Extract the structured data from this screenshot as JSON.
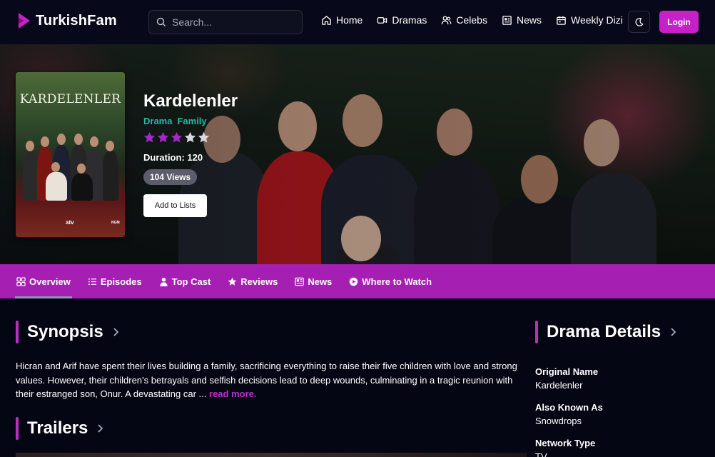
{
  "brand": {
    "name": "TurkishFam",
    "accent": "#c620c9"
  },
  "search": {
    "placeholder": "Search..."
  },
  "nav": {
    "items": [
      {
        "label": "Home",
        "icon": "home-icon"
      },
      {
        "label": "Dramas",
        "icon": "video-icon"
      },
      {
        "label": "Celebs",
        "icon": "users-icon"
      },
      {
        "label": "News",
        "icon": "newspaper-icon"
      },
      {
        "label": "Weekly Dizi",
        "icon": "calendar-icon"
      }
    ],
    "theme_icon": "moon-icon",
    "login_label": "Login"
  },
  "drama": {
    "poster_title": "KARDELENLER",
    "poster_channel": "atv",
    "poster_studio": "NGM",
    "title": "Kardelenler",
    "genres": [
      "Drama",
      "Family"
    ],
    "rating": 3,
    "rating_max": 5,
    "duration": "Duration: 120",
    "views": "104 Views",
    "add_button": "Add to Lists"
  },
  "tabs": [
    {
      "label": "Overview",
      "icon": "grid-icon",
      "active": true
    },
    {
      "label": "Episodes",
      "icon": "list-icon",
      "active": false
    },
    {
      "label": "Top Cast",
      "icon": "user-icon",
      "active": false
    },
    {
      "label": "Reviews",
      "icon": "star-icon",
      "active": false
    },
    {
      "label": "News",
      "icon": "newspaper-icon",
      "active": false
    },
    {
      "label": "Where to Watch",
      "icon": "play-circle-icon",
      "active": false
    }
  ],
  "synopsis": {
    "heading": "Synopsis",
    "text": "Hicran and Arif have spent their lives building a family, sacrificing everything to raise their five children with love and strong values. However, their children’s betrayals and selfish decisions lead to deep wounds, culminating in a tragic reunion with their estranged son, Onur. A devastating car ...",
    "read_more": "read more."
  },
  "trailers": {
    "heading": "Trailers"
  },
  "details": {
    "heading": "Drama Details",
    "items": [
      {
        "label": "Original Name",
        "value": "Kardelenler"
      },
      {
        "label": "Also Known As",
        "value": "Snowdrops"
      },
      {
        "label": "Network Type",
        "value": "TV"
      }
    ]
  },
  "colors": {
    "tab_bar": "#a51fb3",
    "genre": "#1fbba6",
    "star_filled": "#9d2bc4",
    "star_empty": "#d9d9dd",
    "read_more": "#c02fc8"
  }
}
